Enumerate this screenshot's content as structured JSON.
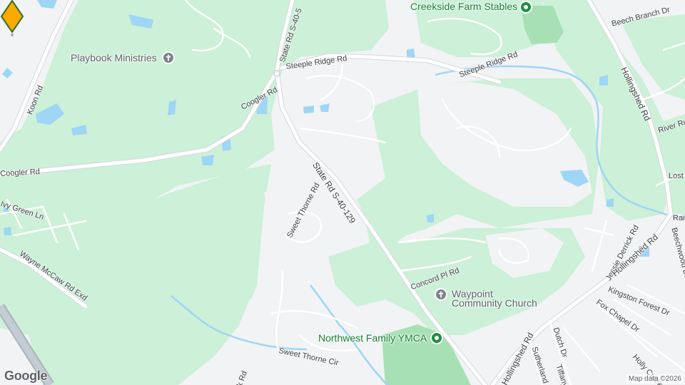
{
  "map": {
    "marker_color": "#f9ab00",
    "green_area_color": "#ccf0d8",
    "park_color": "#a8e0b5",
    "water_color": "#9fd6f5",
    "road_color": "#ffffff",
    "highway_color": "#c3ccd2",
    "attribution": "Map data ©2026",
    "logo": "Google"
  },
  "pois": {
    "creekside": "Creekside Farm Stables",
    "playbook": "Playbook Ministries",
    "waypoint_line1": "Waypoint",
    "waypoint_line2": "Community Church",
    "ymca": "Northwest Family YMCA"
  },
  "roads": {
    "state_rd_top": "State Rd S-40-5",
    "state_rd_main": "State Rd S-40-129",
    "steeple_ridge_1": "Steeple Ridge Rd",
    "steeple_ridge_2": "Steeple Ridge Rd",
    "coogler_1": "Coogler Rd",
    "coogler_2": "Coogler Rd",
    "koon": "Koon Rd",
    "ivy_green": "Ivy Green Ln",
    "wayne_mccaw": "Wayne McCaw Rd Exd",
    "sweet_thorne_rd": "Sweet Thorne Rd",
    "sweet_thorne_cir": "Sweet Thorne Cir",
    "concord_pl": "Concord Pl Rd",
    "beech_branch": "Beech Branch Dr",
    "hollingshed_1": "Hollingshed Rd",
    "hollingshed_2": "Hollingshed Rd",
    "hollingshed_3": "Hollingshed Rd",
    "river_ru": "River Ru",
    "lost": "Lost",
    "jessie_derrick": "Jessie Derrick Rd",
    "kingston_forest": "Kingston Forest Dr",
    "fox_chapel": "Fox Chapel Dr",
    "beechwood": "Beechwood Dr",
    "rai": "Rai",
    "holly_creek": "Holly Creek",
    "dutch": "Dutch Dr",
    "sutherland": "Sutherland Dr",
    "tiffany": "Tiffany Dr",
    "k_rd": "k Rd"
  }
}
